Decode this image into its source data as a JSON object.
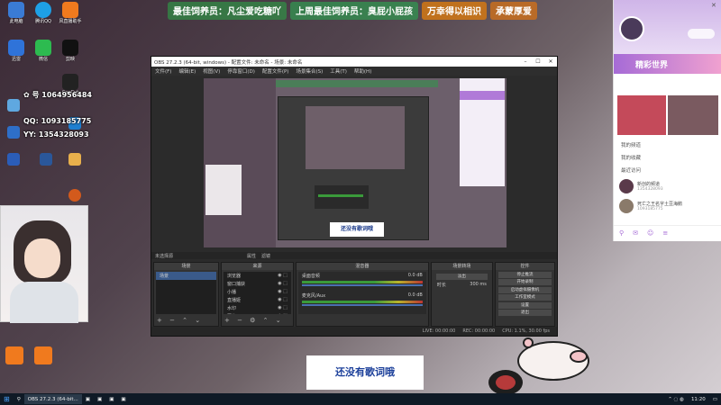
{
  "desktop": {
    "icons": [
      {
        "label": "此电脑",
        "color": "#3a7bd5"
      },
      {
        "label": "腾讯QQ",
        "color": "#1ea0e6"
      },
      {
        "label": "风直播助手",
        "color": "#f07a1e"
      },
      {
        "label": "剪映",
        "color": "#111111"
      },
      {
        "label": "迅雷",
        "color": "#2f73d9"
      },
      {
        "label": "微信",
        "color": "#2dbb50"
      },
      {
        "label": "CapCut",
        "color": "#222222"
      }
    ],
    "id_lines": [
      "1064956484",
      "1093185775",
      "1354328093"
    ],
    "id_prefixes": [
      "✿ 号",
      "QQ:",
      "YY:"
    ]
  },
  "banner": {
    "items": [
      "最佳饲养员：凡尘爱吃糖吖",
      "上周最佳饲养员：臭屁小屁孩",
      "万幸得以相识",
      "承蒙厚爱"
    ]
  },
  "obs": {
    "title": "OBS 27.2.3 (64-bit, windows) - 配置文件: 未命名 - 场景: 未命名",
    "menu": [
      "文件(F)",
      "编辑(E)",
      "视图(V)",
      "停靠窗口(D)",
      "配置文件(P)",
      "场景集合(S)",
      "工具(T)",
      "帮助(H)"
    ],
    "scene_bar": [
      "未选择源",
      "属性",
      "滤镜"
    ],
    "docks": {
      "scenes": {
        "header": "场景",
        "items": [
          "场景"
        ]
      },
      "sources": {
        "header": "来源",
        "items": [
          "浏览器",
          "窗口捕获",
          "小播",
          "直播姬",
          "水印",
          "图片"
        ]
      },
      "mixer": {
        "header": "混音器",
        "channels": [
          {
            "name": "桌面音频",
            "level": "0.0 dB"
          },
          {
            "name": "麦克风/Aux",
            "level": "0.0 dB"
          }
        ]
      },
      "transitions": {
        "header": "场景转场",
        "type": "淡出",
        "duration_label": "时长",
        "duration": "300 ms"
      },
      "controls": {
        "header": "控件",
        "buttons": [
          "停止推流",
          "开始录制",
          "启动虚拟摄像机",
          "工作室模式",
          "设置",
          "退出"
        ]
      }
    },
    "status": [
      "LIVE: 00:00:00",
      "REC: 00:00:00",
      "CPU: 1.1%, 30.00 fps"
    ],
    "subtitle": "还没有歌词哦"
  },
  "right_panel": {
    "banner": "精彩世界",
    "menu": [
      "我的频道",
      "我的收藏",
      "最近访问"
    ],
    "users": [
      {
        "name": "新创的频道",
        "id": "1354328093"
      },
      {
        "name": "死亡之王名字土豆海鹅",
        "id": "1093185775"
      }
    ]
  },
  "taskbar": {
    "app": "OBS 27.2.3 (64-bit...",
    "time": "11:20"
  },
  "colors": {
    "obs_bg": "#2b2b2b",
    "accent_purple": "#a66bd6",
    "taskbar": "#0f1a26"
  }
}
